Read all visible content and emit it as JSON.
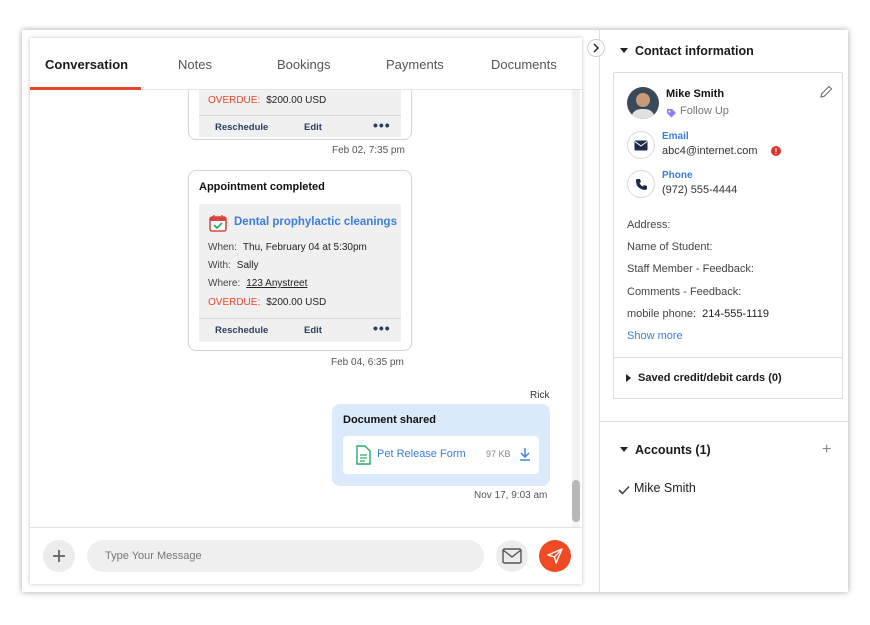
{
  "tabs": [
    "Conversation",
    "Notes",
    "Bookings",
    "Payments",
    "Documents"
  ],
  "appointment_prev": {
    "overdue_label": "OVERDUE:",
    "amount": "$200.00 USD",
    "reschedule": "Reschedule",
    "edit": "Edit",
    "more": "•••",
    "timestamp": "Feb 02, 7:35 pm"
  },
  "appointment": {
    "title": "Appointment completed",
    "name": "Dental prophylactic cleanings",
    "when_label": "When:",
    "when": "Thu, February 04 at 5:30pm",
    "with_label": "With:",
    "with": "Sally",
    "where_label": "Where:",
    "where": "123 Anystreet",
    "overdue_label": "OVERDUE:",
    "amount": "$200.00 USD",
    "reschedule": "Reschedule",
    "edit": "Edit",
    "more": "•••",
    "timestamp": "Feb 04, 6:35 pm"
  },
  "document": {
    "sender": "Rick",
    "title": "Document shared",
    "file_name": "Pet Release Form",
    "file_size": "97 KB",
    "timestamp": "Nov 17, 9:03 am"
  },
  "composer": {
    "placeholder": "Type Your Message"
  },
  "contact": {
    "section_title": "Contact information",
    "name": "Mike Smith",
    "tag": "Follow Up",
    "email_label": "Email",
    "email": "abc4@internet.com",
    "phone_label": "Phone",
    "phone": "(972) 555-4444",
    "address_label": "Address:",
    "student_label": "Name of Student:",
    "staff_label": "Staff Member - Feedback:",
    "comments_label": "Comments - Feedback:",
    "mobile_label": "mobile phone:",
    "mobile": "214-555-1119",
    "show_more": "Show more",
    "cards_label": "Saved credit/debit cards (0)"
  },
  "accounts": {
    "title": "Accounts (1)",
    "items": [
      "Mike Smith"
    ]
  },
  "colors": {
    "accent": "#e8462a",
    "link": "#3b7ddd",
    "bubble": "#dbeafb",
    "tag": "#8b7cf0"
  }
}
